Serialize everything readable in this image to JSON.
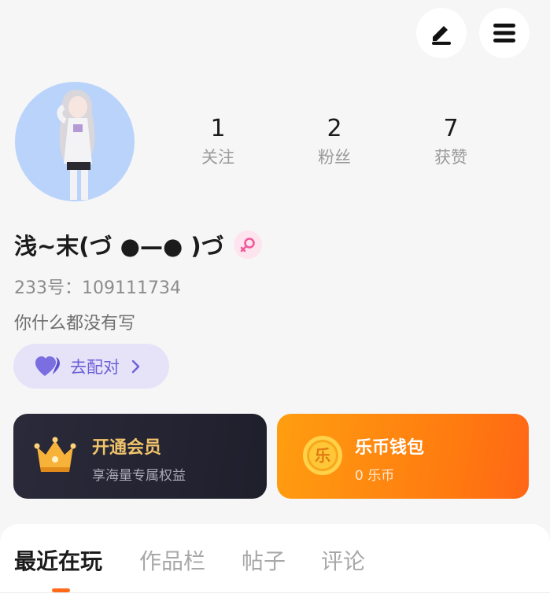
{
  "header": {
    "edit_icon": "pencil-icon",
    "menu_icon": "menu-icon"
  },
  "profile": {
    "avatar_icon": "anime-avatar",
    "stats": [
      {
        "value": "1",
        "label": "关注"
      },
      {
        "value": "2",
        "label": "粉丝"
      },
      {
        "value": "7",
        "label": "获赞"
      }
    ],
    "username": "浅~末(づ ●—● )づ",
    "gender_icon": "female-icon",
    "uid_line": "233号：109111734",
    "bio": "你什么都没有写"
  },
  "pair_button": {
    "label": "去配对",
    "icon": "heart-icon",
    "color": "#6a5fd8"
  },
  "vip_card": {
    "title": "开通会员",
    "subtitle": "享海量专属权益",
    "icon": "crown-icon"
  },
  "wallet_card": {
    "title": "乐币钱包",
    "subtitle": "0 乐币",
    "coin_glyph": "乐",
    "icon": "coin-icon"
  },
  "tabs": [
    {
      "label": "最近在玩",
      "active": true
    },
    {
      "label": "作品栏",
      "active": false
    },
    {
      "label": "帖子",
      "active": false
    },
    {
      "label": "评论",
      "active": false
    }
  ],
  "colors": {
    "accent": "#ff6a1a",
    "wallet": "#ff8a10",
    "vip_gold": "#f0c46a"
  }
}
